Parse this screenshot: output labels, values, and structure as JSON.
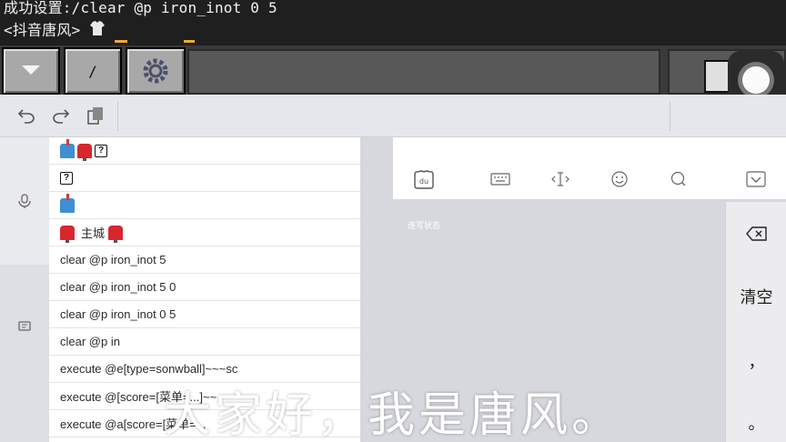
{
  "minecraft": {
    "chat_line_1": "成功设置:/clear @p iron_inot 0 5",
    "chat_line_2": "<抖音唐风>",
    "hotbar": {
      "dropdown_symbol": "▼",
      "slash_label": "/"
    }
  },
  "toolbar": {
    "undo_icon": "undo-icon",
    "redo_icon": "redo-icon",
    "clipboard_icon": "clipboard-icon"
  },
  "clipboard": {
    "items": [
      {
        "text": ""
      },
      {
        "text": ""
      },
      {
        "text": ""
      },
      {
        "text": "主城"
      },
      {
        "text": "clear @p iron_inot 5"
      },
      {
        "text": "clear @p iron_inot 5 0"
      },
      {
        "text": "clear @p iron_inot 0 5"
      },
      {
        "text": "clear @p in"
      },
      {
        "text": "execute @e[type=sonwball]~~~sc"
      },
      {
        "text": "execute @[score=[菜单=...]~~"
      },
      {
        "text": "execute @a[score=[菜单=..."
      }
    ]
  },
  "keyboard": {
    "status_text": "连写状态",
    "keys": {
      "clear_label": "清空",
      "comma_label": "，",
      "period_label": "。"
    }
  },
  "subtitle": "大家好，我是唐风。",
  "colors": {
    "mc_bg": "#1f1f1f",
    "accent_orange": "#f3a73a",
    "kb_bg": "#d6d8de"
  }
}
